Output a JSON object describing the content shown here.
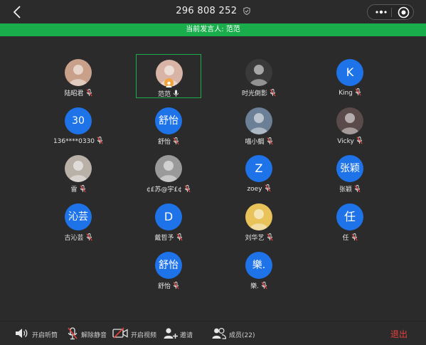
{
  "header": {
    "meeting_id": "296 808 252",
    "back_icon": "chevron-left-icon",
    "shield_icon": "shield-icon",
    "more_icon": "more-dots-icon",
    "target_icon": "record-target-icon"
  },
  "banner": {
    "text": "当前发言人: 范范"
  },
  "participants": [
    {
      "name": "陆昭君",
      "avatar": "photo",
      "mic": "muted"
    },
    {
      "name": "范范",
      "avatar": "photo",
      "mic": "on",
      "active": true,
      "host": true
    },
    {
      "name": "时光倒影",
      "avatar": "photo",
      "mic": "muted"
    },
    {
      "name": "King",
      "avatar": "K",
      "mic": "muted"
    },
    {
      "name": "136****0330",
      "avatar": "30",
      "mic": "muted"
    },
    {
      "name": "舒怡",
      "avatar": "舒怡",
      "mic": "muted"
    },
    {
      "name": "喵小鲷",
      "avatar": "photo",
      "mic": "muted"
    },
    {
      "name": "Vicky",
      "avatar": "photo",
      "mic": "muted"
    },
    {
      "name": "雷",
      "avatar": "photo",
      "mic": "muted"
    },
    {
      "name": "¢£苏@宇£¢",
      "avatar": "photo",
      "mic": "muted"
    },
    {
      "name": "zoey",
      "avatar": "Z",
      "mic": "muted"
    },
    {
      "name": "张颖",
      "avatar": "张颖",
      "mic": "muted"
    },
    {
      "name": "古沁芸",
      "avatar": "沁芸",
      "mic": "muted"
    },
    {
      "name": "戴哲予",
      "avatar": "D",
      "mic": "muted"
    },
    {
      "name": "刘华艺",
      "avatar": "photo",
      "mic": "muted"
    },
    {
      "name": "任",
      "avatar": "任",
      "mic": "muted"
    },
    {
      "name": "舒怡",
      "avatar": "舒怡",
      "mic": "muted"
    },
    {
      "name": "樂.",
      "avatar": "樂.",
      "mic": "muted"
    }
  ],
  "toolbar": {
    "speaker_label": "开启听筒",
    "unmute_label": "解除静音",
    "video_label": "开启视频",
    "invite_label": "邀请",
    "members_label": "成员(22)",
    "exit_label": "退出"
  },
  "colors": {
    "accent_green": "#1aad4b",
    "avatar_blue": "#1e73e8",
    "exit_red": "#e8413e",
    "mute_red": "#e8413e",
    "background": "#2b2b2b"
  }
}
